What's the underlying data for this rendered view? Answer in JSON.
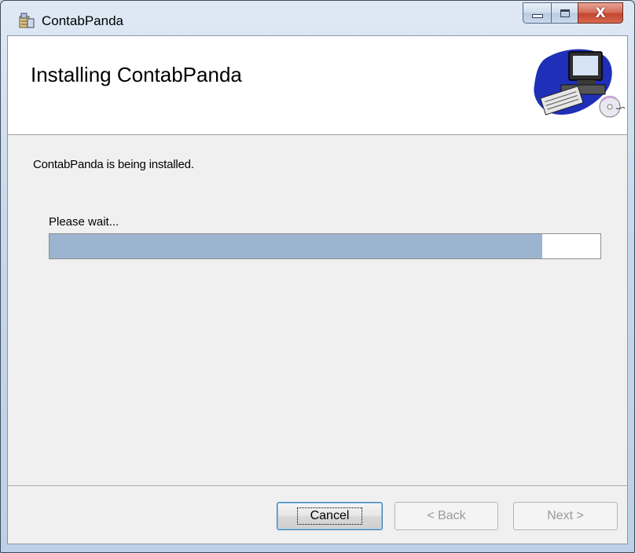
{
  "window": {
    "title": "ContabPanda",
    "close_glyph": "X"
  },
  "banner": {
    "title": "Installing ContabPanda",
    "art_icon": "computer-with-cd-icon"
  },
  "status": {
    "message": "ContabPanda is being installed.",
    "wait_label": "Please wait...",
    "progress_fraction": 0.895
  },
  "buttons": {
    "cancel": "Cancel",
    "back": "< Back",
    "next": "Next >"
  },
  "colors": {
    "progress_fill": "#9cb4d0",
    "banner_bg": "#ffffff",
    "client_bg": "#f0f0f0"
  }
}
